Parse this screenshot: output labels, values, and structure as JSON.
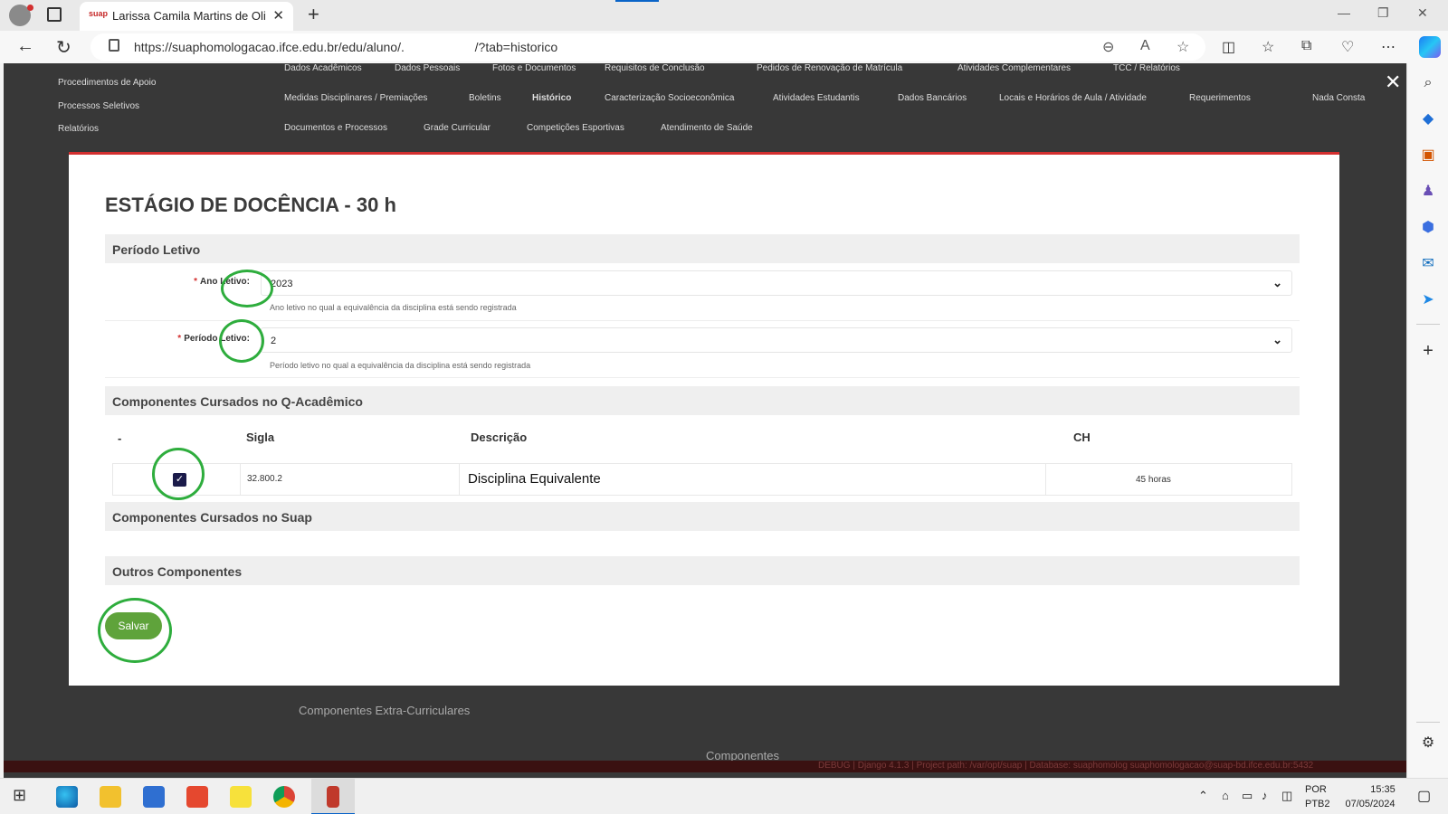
{
  "browser": {
    "tab_title": "Larissa Camila Martins de Oliveira",
    "tab_favicon": "suap",
    "url": "https://suaphomologacao.ifce.edu.br/edu/aluno/.                    /?tab=historico",
    "accent_color": "#0a64c8"
  },
  "background": {
    "menu_items": [
      "Procedimentos de Apoio",
      "Processos Seletivos",
      "Relatórios"
    ],
    "tabs_row1": [
      "Dados Acadêmicos",
      "Dados Pessoais",
      "Fotos e Documentos",
      "Requisitos de Conclusão",
      "Pedidos de Renovação de Matrícula",
      "Atividades Complementares",
      "TCC / Relatórios"
    ],
    "tabs_row2": [
      "Medidas Disciplinares / Premiações",
      "Boletins",
      "Histórico",
      "Caracterização Socioeconômica",
      "Atividades Estudantis",
      "Dados Bancários",
      "Locais e Horários de Aula / Atividade",
      "Requerimentos",
      "Nada Consta"
    ],
    "tabs_row3": [
      "Documentos e Processos",
      "Grade Curricular",
      "Competições Esportivas",
      "Atendimento de Saúde"
    ],
    "section_extra": "Componentes Extra-Curriculares",
    "section_components": "Componentes",
    "footer_text": "DEBUG | Django 4.1.3 | Project path: /var/opt/suap | Database: suaphomolog suaphomologacao@suap-bd.ifce.edu.br:5432"
  },
  "modal": {
    "title": "ESTÁGIO DE DOCÊNCIA - 30 h",
    "period_section": "Período Letivo",
    "ano_label": "Ano Letivo:",
    "ano_value": "2023",
    "ano_help": "Ano letivo no qual a equivalência da disciplina está sendo registrada",
    "periodo_label": "Período Letivo:",
    "periodo_value": "2",
    "periodo_help": "Período letivo no qual a equivalência da disciplina está sendo registrada",
    "qacademico_section": "Componentes Cursados no Q-Acadêmico",
    "table_headers": {
      "select": "-",
      "sigla": "Sigla",
      "descricao": "Descrição",
      "ch": "CH"
    },
    "rows": [
      {
        "checked": true,
        "sigla": "32.800.2",
        "descricao": "Disciplina Equivalente",
        "ch": "45 horas"
      }
    ],
    "suap_section": "Componentes Cursados no Suap",
    "outros_section": "Outros Componentes",
    "save_label": "Salvar",
    "accent_color": "#d32f2f",
    "button_color": "#5fa33b"
  },
  "taskbar": {
    "lang": "POR",
    "layout": "PTB2",
    "time": "15:35",
    "date": "07/05/2024"
  }
}
